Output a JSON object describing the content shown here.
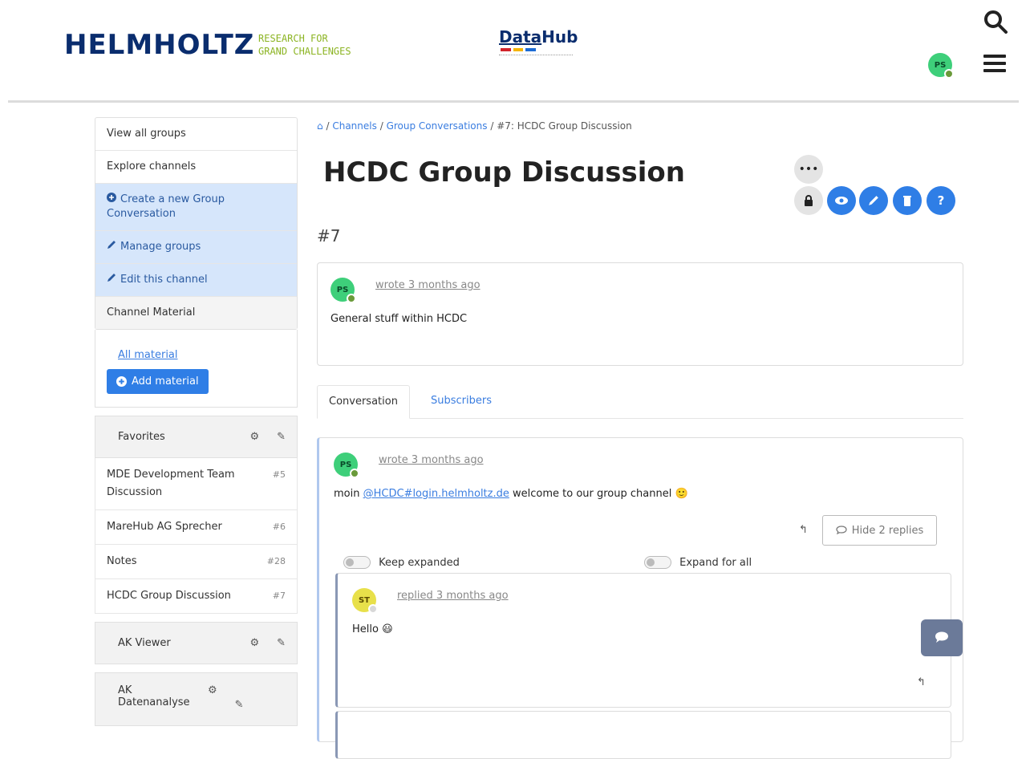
{
  "header": {
    "brand": "HELMHOLTZ",
    "brand_tagline_1": "RESEARCH FOR",
    "brand_tagline_2": "GRAND CHALLENGES",
    "datahub_prefix": "Data",
    "datahub_suffix": "Hub",
    "user_initials": "PS",
    "icons": [
      "search-icon",
      "hamburger-menu-icon"
    ]
  },
  "colors": {
    "primary": "#2f7ee6",
    "brand_navy": "#0a2d6e",
    "brand_green": "#8cb423",
    "sidebar_highlight": "#d6e6fb",
    "avatar_green": "#3ecf7a",
    "avatar_yellow": "#e8e04a"
  },
  "sidebar": {
    "items": [
      {
        "label": "View all groups"
      },
      {
        "label": "Explore channels"
      },
      {
        "label": "Create a new Group Conversation",
        "icon": "plus-circle-icon"
      },
      {
        "label": "Manage groups",
        "icon": "pencil-icon"
      },
      {
        "label": "Edit this channel",
        "icon": "pencil-icon"
      },
      {
        "label": "Channel Material"
      }
    ],
    "material_link": "All material",
    "add_material_label": "Add material",
    "favorites": {
      "title": "Favorites",
      "items": [
        {
          "name": "MDE Development Team Discussion",
          "num": "#5"
        },
        {
          "name": "MareHub AG Sprecher",
          "num": "#6"
        },
        {
          "name": "Notes",
          "num": "#28"
        },
        {
          "name": "HCDC Group Discussion",
          "num": "#7"
        }
      ]
    },
    "groups": [
      {
        "title": "AK Viewer"
      },
      {
        "title": "AK Datenanalyse"
      }
    ]
  },
  "breadcrumb": {
    "channels": "Channels",
    "group_conversations": "Group Conversations",
    "current": "#7: HCDC Group Discussion",
    "sep": "/"
  },
  "page": {
    "title": "HCDC Group Discussion",
    "hash": "#7"
  },
  "channel_post": {
    "initials": "PS",
    "meta": "wrote 3 months ago",
    "body": "General stuff within HCDC"
  },
  "tabs": [
    {
      "label": "Conversation",
      "active": true
    },
    {
      "label": "Subscribers",
      "active": false
    }
  ],
  "conversation": {
    "initials": "PS",
    "meta": "wrote 3 months ago",
    "body_prefix": "moin ",
    "mention": "@HCDC#login.helmholtz.de",
    "body_suffix": " welcome to our group channel 🙂",
    "hide_replies_label": "Hide 2 replies",
    "keep_expanded_label": "Keep expanded",
    "expand_for_all_label": "Expand for all",
    "reply": {
      "initials": "ST",
      "meta": "replied 3 months ago",
      "body": "Hello 😃"
    }
  }
}
